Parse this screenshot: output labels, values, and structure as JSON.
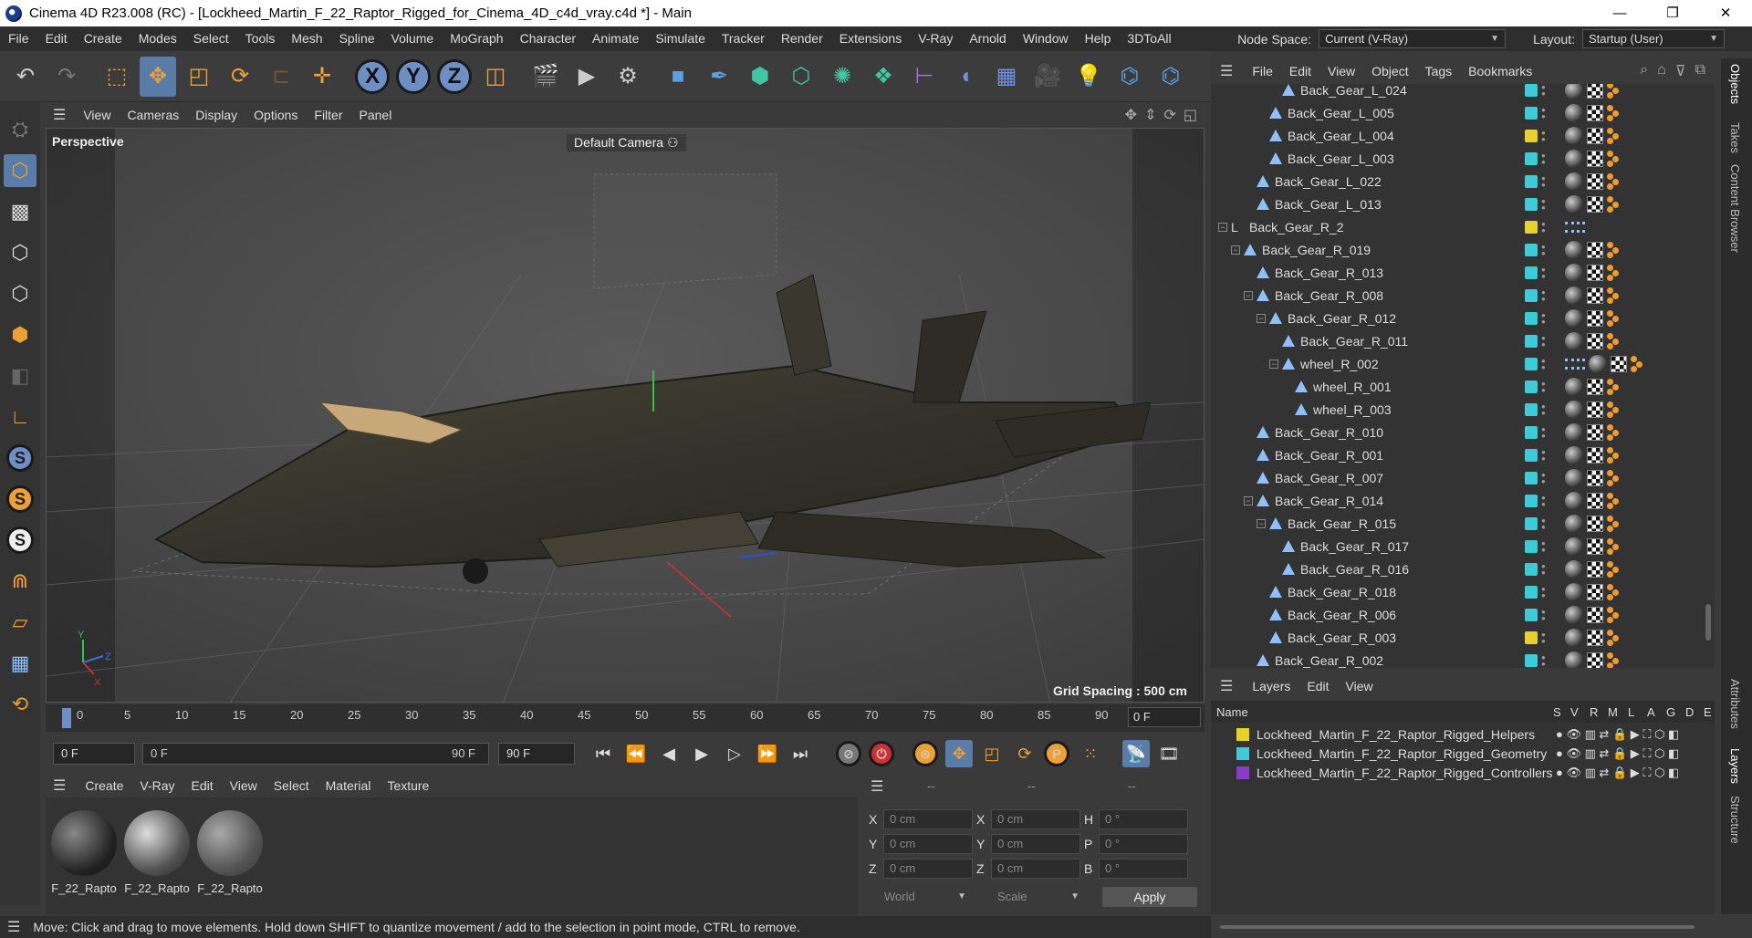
{
  "window": {
    "title": "Cinema 4D R23.008 (RC) - [Lockheed_Martin_F_22_Raptor_Rigged_for_Cinema_4D_c4d_vray.c4d *] - Main",
    "minimize": "—",
    "restore": "❐",
    "close": "✕"
  },
  "menubar": {
    "items": [
      "File",
      "Edit",
      "Create",
      "Modes",
      "Select",
      "Tools",
      "Mesh",
      "Spline",
      "Volume",
      "MoGraph",
      "Character",
      "Animate",
      "Simulate",
      "Tracker",
      "Render",
      "Extensions",
      "V-Ray",
      "Arnold",
      "Window",
      "Help",
      "3DToAll"
    ],
    "node_space_label": "Node Space:",
    "node_space_value": "Current (V-Ray)",
    "layout_label": "Layout:",
    "layout_value": "Startup (User)"
  },
  "toolbar": {
    "axis_x": "X",
    "axis_y": "Y",
    "axis_z": "Z"
  },
  "viewport": {
    "menu": [
      "View",
      "Cameras",
      "Display",
      "Options",
      "Filter",
      "Panel"
    ],
    "view_name": "Perspective",
    "camera": "Default Camera",
    "grid_spacing": "Grid Spacing : 500 cm",
    "axis_labels": {
      "y": "Y",
      "z": "Z",
      "x": "X"
    }
  },
  "timeline": {
    "ticks": [
      "0",
      "5",
      "10",
      "15",
      "20",
      "25",
      "30",
      "35",
      "40",
      "45",
      "50",
      "55",
      "60",
      "65",
      "70",
      "75",
      "80",
      "85",
      "90"
    ],
    "current_frame": "0 F",
    "start_field": "0 F",
    "range_start": "0 F",
    "range_end": "90 F",
    "end_field": "90 F"
  },
  "material_manager": {
    "menu": [
      "Create",
      "V-Ray",
      "Edit",
      "View",
      "Select",
      "Material",
      "Texture"
    ],
    "materials": [
      {
        "name": "F_22_Rapto"
      },
      {
        "name": "F_22_Rapto"
      },
      {
        "name": "F_22_Rapto"
      }
    ]
  },
  "coordinates": {
    "headers": [
      "--",
      "--",
      "--"
    ],
    "rows": [
      {
        "a": "X",
        "av": "0 cm",
        "b": "X",
        "bv": "0 cm",
        "c": "H",
        "cv": "0 °"
      },
      {
        "a": "Y",
        "av": "0 cm",
        "b": "Y",
        "bv": "0 cm",
        "c": "P",
        "cv": "0 °"
      },
      {
        "a": "Z",
        "av": "0 cm",
        "b": "Z",
        "bv": "0 cm",
        "c": "B",
        "cv": "0 °"
      }
    ],
    "space": "World",
    "mode": "Scale",
    "apply": "Apply"
  },
  "object_manager": {
    "menu": [
      "File",
      "Edit",
      "View",
      "Object",
      "Tags",
      "Bookmarks"
    ],
    "objects": [
      {
        "name": "Back_Gear_L_024",
        "depth": 5,
        "color": "#3ccbd8",
        "exp": ""
      },
      {
        "name": "Back_Gear_L_005",
        "depth": 4,
        "color": "#3ccbd8",
        "exp": ""
      },
      {
        "name": "Back_Gear_L_004",
        "depth": 4,
        "color": "#e8d22a",
        "exp": ""
      },
      {
        "name": "Back_Gear_L_003",
        "depth": 4,
        "color": "#3ccbd8",
        "exp": ""
      },
      {
        "name": "Back_Gear_L_022",
        "depth": 3,
        "color": "#3ccbd8",
        "exp": ""
      },
      {
        "name": "Back_Gear_L_013",
        "depth": 3,
        "color": "#3ccbd8",
        "exp": ""
      },
      {
        "name": "Back_Gear_R_2",
        "depth": 1,
        "color": "#e8d22a",
        "exp": "−",
        "null": true
      },
      {
        "name": "Back_Gear_R_019",
        "depth": 2,
        "color": "#3ccbd8",
        "exp": "−"
      },
      {
        "name": "Back_Gear_R_013",
        "depth": 3,
        "color": "#3ccbd8",
        "exp": ""
      },
      {
        "name": "Back_Gear_R_008",
        "depth": 3,
        "color": "#3ccbd8",
        "exp": "−"
      },
      {
        "name": "Back_Gear_R_012",
        "depth": 4,
        "color": "#3ccbd8",
        "exp": "−"
      },
      {
        "name": "Back_Gear_R_011",
        "depth": 5,
        "color": "#3ccbd8",
        "exp": ""
      },
      {
        "name": "wheel_R_002",
        "depth": 5,
        "color": "#3ccbd8",
        "exp": "−",
        "ctrl": true
      },
      {
        "name": "wheel_R_001",
        "depth": 6,
        "color": "#3ccbd8",
        "exp": ""
      },
      {
        "name": "wheel_R_003",
        "depth": 6,
        "color": "#3ccbd8",
        "exp": ""
      },
      {
        "name": "Back_Gear_R_010",
        "depth": 3,
        "color": "#3ccbd8",
        "exp": ""
      },
      {
        "name": "Back_Gear_R_001",
        "depth": 3,
        "color": "#3ccbd8",
        "exp": ""
      },
      {
        "name": "Back_Gear_R_007",
        "depth": 3,
        "color": "#3ccbd8",
        "exp": ""
      },
      {
        "name": "Back_Gear_R_014",
        "depth": 3,
        "color": "#3ccbd8",
        "exp": "−"
      },
      {
        "name": "Back_Gear_R_015",
        "depth": 4,
        "color": "#3ccbd8",
        "exp": "−"
      },
      {
        "name": "Back_Gear_R_017",
        "depth": 5,
        "color": "#3ccbd8",
        "exp": ""
      },
      {
        "name": "Back_Gear_R_016",
        "depth": 5,
        "color": "#3ccbd8",
        "exp": ""
      },
      {
        "name": "Back_Gear_R_018",
        "depth": 4,
        "color": "#3ccbd8",
        "exp": ""
      },
      {
        "name": "Back_Gear_R_006",
        "depth": 4,
        "color": "#3ccbd8",
        "exp": ""
      },
      {
        "name": "Back_Gear_R_003",
        "depth": 4,
        "color": "#e8d22a",
        "exp": ""
      },
      {
        "name": "Back_Gear_R_002",
        "depth": 3,
        "color": "#3ccbd8",
        "exp": ""
      }
    ]
  },
  "layers": {
    "menu": [
      "Layers",
      "Edit",
      "View"
    ],
    "columns": {
      "name": "Name",
      "flags": [
        "S",
        "V",
        "R",
        "M",
        "L",
        "A",
        "G",
        "D",
        "E"
      ]
    },
    "items": [
      {
        "name": "Lockheed_Martin_F_22_Raptor_Rigged_Helpers",
        "color": "#e8d22a"
      },
      {
        "name": "Lockheed_Martin_F_22_Raptor_Rigged_Geometry",
        "color": "#3ccbd8"
      },
      {
        "name": "Lockheed_Martin_F_22_Raptor_Rigged_Controllers",
        "color": "#8a3cc8"
      }
    ]
  },
  "side_tabs": [
    "Objects",
    "Takes",
    "Content Browser",
    "Attributes",
    "Layers",
    "Structure"
  ],
  "status": {
    "message": "Move: Click and drag to move elements. Hold down SHIFT to quantize movement / add to the selection in point mode, CTRL to remove."
  }
}
